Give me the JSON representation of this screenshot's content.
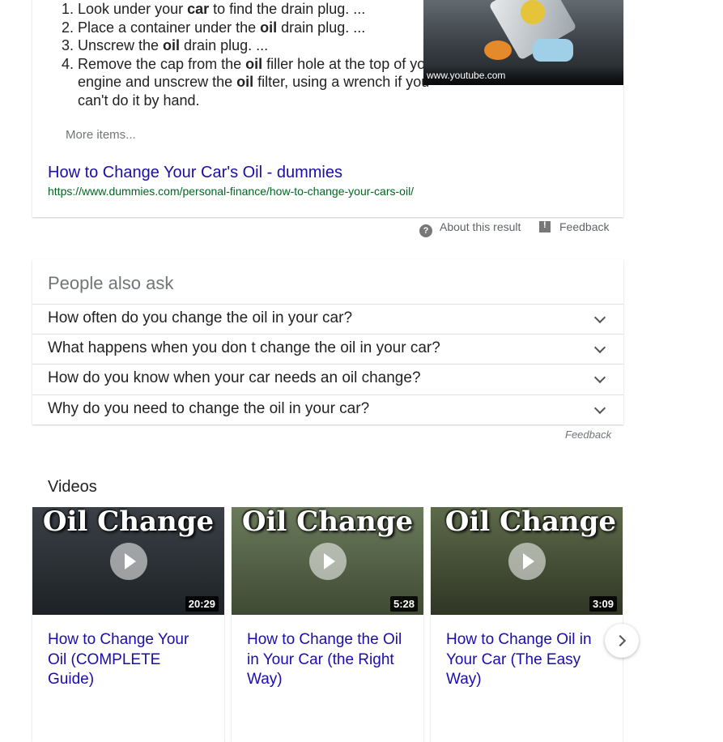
{
  "snippet": {
    "steps": [
      {
        "parts": [
          "Look under your ",
          "car",
          " to find the drain plug. ..."
        ]
      },
      {
        "parts": [
          "Place a container under the ",
          "oil",
          " drain plug. ..."
        ]
      },
      {
        "parts": [
          "Unscrew the ",
          "oil",
          " drain plug. ..."
        ]
      },
      {
        "parts": [
          "Remove the cap from the ",
          "oil",
          " filler hole at the top of your engine and unscrew the ",
          "oil",
          " filter, using a wrench if you can't do it by hand."
        ]
      }
    ],
    "more_items": "More items...",
    "image_source": "www.youtube.com",
    "result_title": "How to Change Your Car's Oil - dummies",
    "result_url": "https://www.dummies.com/personal-finance/how-to-change-your-cars-oil/"
  },
  "about_result": "About this result",
  "feedback_label": "Feedback",
  "people_also_ask": {
    "title": "People also ask",
    "questions": [
      "How often do you change the oil in your car?",
      "What happens when you don t change the oil in your car?",
      "How do you know when your car needs an oil change?",
      "Why do you need to change the oil in your car?"
    ],
    "feedback": "Feedback"
  },
  "videos": {
    "title": "Videos",
    "items": [
      {
        "thumb_text": "Oil Change",
        "duration": "20:29",
        "title": "How to Change Your Oil (COMPLETE Guide)",
        "colors": [
          "#3a4046",
          "#1d2226"
        ]
      },
      {
        "thumb_text": "Oil Change",
        "duration": "5:28",
        "title": "How to Change the Oil in Your Car (the Right Way)",
        "colors": [
          "#6b7a5c",
          "#3e4a33"
        ]
      },
      {
        "thumb_text": "Oil Change",
        "duration": "3:09",
        "title": "How to Change Oil in Your Car (The Easy Way)",
        "colors": [
          "#5d6a4a",
          "#2f3524"
        ]
      }
    ]
  }
}
